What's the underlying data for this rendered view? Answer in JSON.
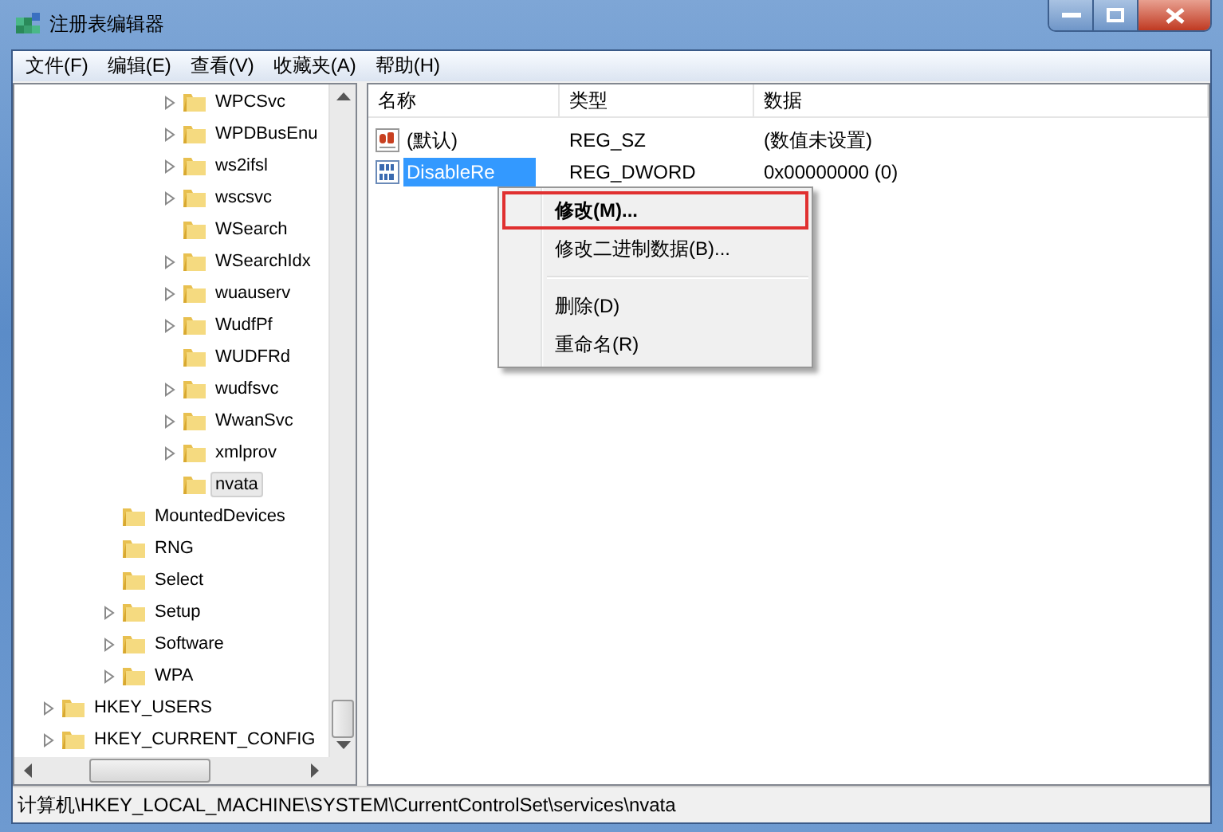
{
  "window": {
    "title": "注册表编辑器"
  },
  "menu": [
    "文件(F)",
    "编辑(E)",
    "查看(V)",
    "收藏夹(A)",
    "帮助(H)"
  ],
  "tree": [
    {
      "children": [
        {
          "children": [
            {
              "children": [
                {
                  "children": [
                    {
                      "label": "WPCSvc",
                      "expandable": true,
                      "selected": false
                    },
                    {
                      "label": "WPDBusEnu",
                      "expandable": true,
                      "selected": false
                    },
                    {
                      "label": "ws2ifsl",
                      "expandable": true,
                      "selected": false
                    },
                    {
                      "label": "wscsvc",
                      "expandable": true,
                      "selected": false
                    },
                    {
                      "label": "WSearch",
                      "expandable": false,
                      "selected": false
                    },
                    {
                      "label": "WSearchIdx",
                      "expandable": true,
                      "selected": false
                    },
                    {
                      "label": "wuauserv",
                      "expandable": true,
                      "selected": false
                    },
                    {
                      "label": "WudfPf",
                      "expandable": true,
                      "selected": false
                    },
                    {
                      "label": "WUDFRd",
                      "expandable": false,
                      "selected": false
                    },
                    {
                      "label": "wudfsvc",
                      "expandable": true,
                      "selected": false
                    },
                    {
                      "label": "WwanSvc",
                      "expandable": true,
                      "selected": false
                    },
                    {
                      "label": "xmlprov",
                      "expandable": true,
                      "selected": false
                    },
                    {
                      "label": "nvata",
                      "expandable": false,
                      "selected": true
                    }
                  ]
                }
              ]
            },
            {
              "label": "MountedDevices",
              "expandable": false,
              "selected": false
            },
            {
              "label": "RNG",
              "expandable": false,
              "selected": false
            },
            {
              "label": "Select",
              "expandable": false,
              "selected": false
            },
            {
              "label": "Setup",
              "expandable": true,
              "selected": false
            },
            {
              "label": "Software",
              "expandable": true,
              "selected": false
            },
            {
              "label": "WPA",
              "expandable": true,
              "selected": false
            }
          ]
        }
      ]
    },
    {
      "label": "HKEY_USERS",
      "expandable": true,
      "selected": false
    },
    {
      "label": "HKEY_CURRENT_CONFIG",
      "expandable": true,
      "selected": false
    }
  ],
  "values_table": {
    "columns": [
      "名称",
      "类型",
      "数据"
    ],
    "rows": [
      {
        "kind": "string",
        "name": "(默认)",
        "type": "REG_SZ",
        "data": "(数值未设置)",
        "selected": false
      },
      {
        "kind": "binary",
        "name": "DisableRe",
        "type": "REG_DWORD",
        "data": "0x00000000 (0)",
        "selected": true
      }
    ]
  },
  "context_menu": [
    {
      "kind": "item",
      "label": "修改(M)...",
      "default": true,
      "selected": true
    },
    {
      "kind": "item",
      "label": "修改二进制数据(B)...",
      "default": false,
      "selected": false
    },
    {
      "kind": "separator"
    },
    {
      "kind": "item",
      "label": "删除(D)",
      "default": false,
      "selected": false
    },
    {
      "kind": "item",
      "label": "重命名(R)",
      "default": false,
      "selected": false
    }
  ],
  "status_bar": "计算机\\HKEY_LOCAL_MACHINE\\SYSTEM\\CurrentControlSet\\services\\nvata"
}
